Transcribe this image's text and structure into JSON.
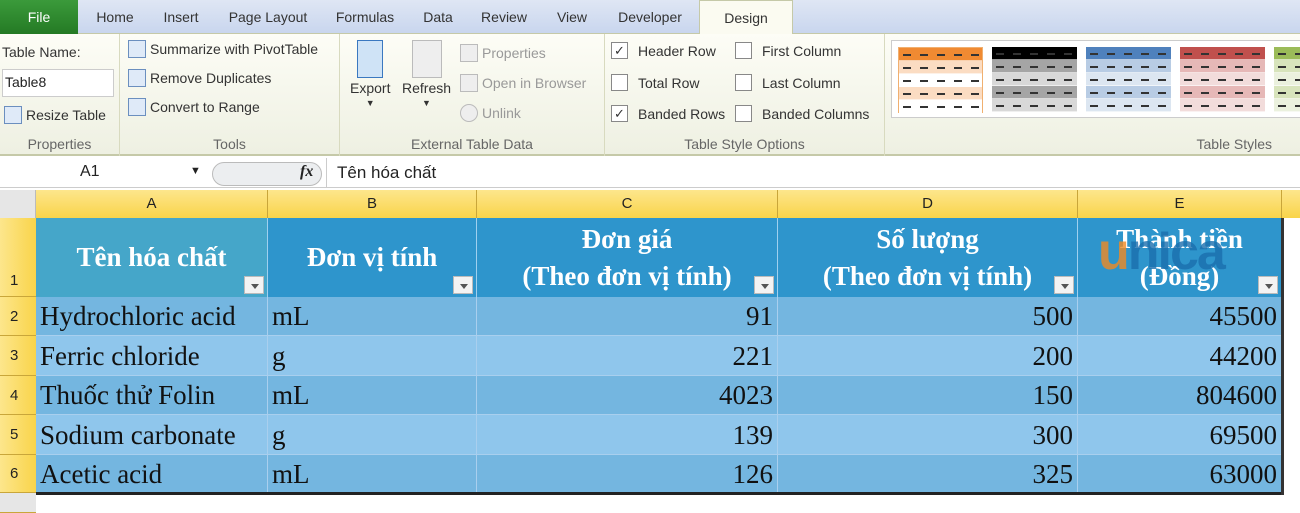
{
  "tabs": [
    "File",
    "Home",
    "Insert",
    "Page Layout",
    "Formulas",
    "Data",
    "Review",
    "View",
    "Developer",
    "Design"
  ],
  "ribbon": {
    "properties": {
      "table_name_label": "Table Name:",
      "table_name_value": "Table8",
      "resize": "Resize Table",
      "group": "Properties"
    },
    "tools": {
      "pivot": "Summarize with PivotTable",
      "dup": "Remove Duplicates",
      "convert": "Convert to Range",
      "group": "Tools"
    },
    "external": {
      "export": "Export",
      "refresh": "Refresh",
      "properties": "Properties",
      "open_browser": "Open in Browser",
      "unlink": "Unlink",
      "group": "External Table Data"
    },
    "style_options": {
      "header_row": "Header Row",
      "total_row": "Total Row",
      "banded_rows": "Banded Rows",
      "first_column": "First Column",
      "last_column": "Last Column",
      "banded_columns": "Banded Columns",
      "group": "Table Style Options",
      "checked": {
        "header_row": true,
        "total_row": false,
        "banded_rows": true,
        "first_column": false,
        "last_column": false,
        "banded_columns": false
      }
    },
    "styles": {
      "group": "Table Styles"
    }
  },
  "formula_bar": {
    "cell_ref": "A1",
    "fx": "fx",
    "value": "Tên hóa chất"
  },
  "sheet": {
    "columns": [
      "A",
      "B",
      "C",
      "D",
      "E"
    ],
    "row_numbers": [
      "1",
      "2",
      "3",
      "4",
      "5",
      "6"
    ],
    "headers": [
      [
        "Tên hóa chất"
      ],
      [
        "Đơn vị tính"
      ],
      [
        "Đơn giá",
        "(Theo đơn vị tính)"
      ],
      [
        "Số lượng",
        "(Theo đơn vị tính)"
      ],
      [
        "Thành tiền",
        "(Đồng)"
      ]
    ],
    "rows": [
      [
        "Hydrochloric acid",
        "mL",
        "91",
        "500",
        "45500"
      ],
      [
        "Ferric chloride",
        "g",
        "221",
        "200",
        "44200"
      ],
      [
        "Thuốc thử Folin",
        "mL",
        "4023",
        "150",
        "804600"
      ],
      [
        "Sodium carbonate",
        "g",
        "139",
        "300",
        "69500"
      ],
      [
        "Acetic acid",
        "mL",
        "126",
        "325",
        "63000"
      ]
    ]
  },
  "watermark": "unica",
  "colors": {
    "header": "#2e95cc",
    "band_dark": "#74b6e0",
    "band_light": "#8fc6ec",
    "file_tab": "#2f8a2f"
  }
}
